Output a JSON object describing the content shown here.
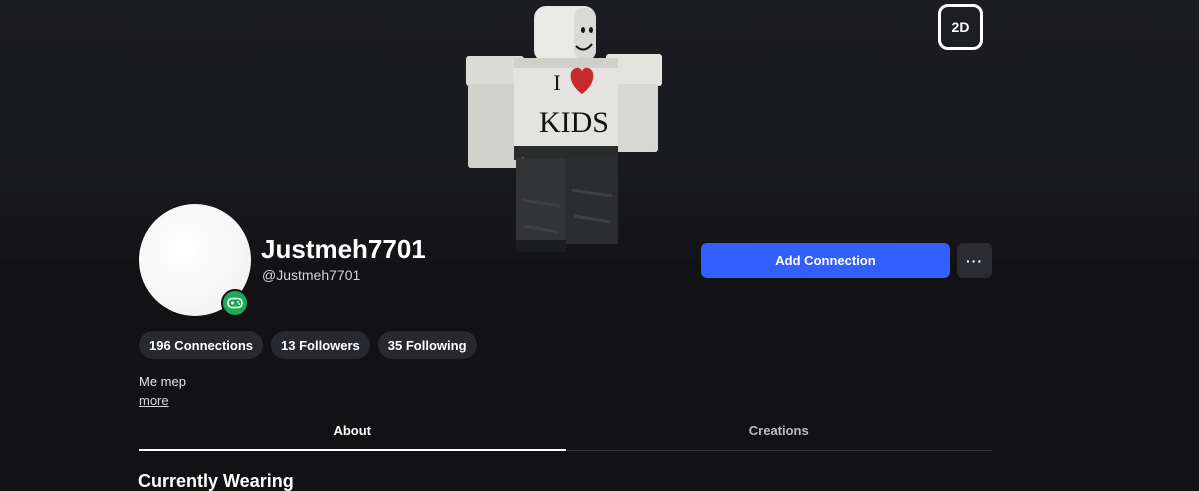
{
  "view_toggle": {
    "label": "2D"
  },
  "avatar": {
    "shirt_line1_letter": "I",
    "shirt_line2": "KIDS",
    "heart_icon": "heart-icon"
  },
  "profile": {
    "display_name": "Justmeh7701",
    "username": "@Justmeh7701",
    "presence_icon": "gamepad-icon",
    "presence_color": "#1fa95a"
  },
  "actions": {
    "add_connection_label": "Add Connection",
    "more_label": "···",
    "accent_color": "#335fff"
  },
  "stats": [
    {
      "label": "196 Connections"
    },
    {
      "label": "13 Followers"
    },
    {
      "label": "35 Following"
    }
  ],
  "about": {
    "text": "Me mep",
    "more_label": "more"
  },
  "tabs": [
    {
      "label": "About",
      "active": true
    },
    {
      "label": "Creations",
      "active": false
    }
  ],
  "section": {
    "title": "Currently Wearing"
  }
}
